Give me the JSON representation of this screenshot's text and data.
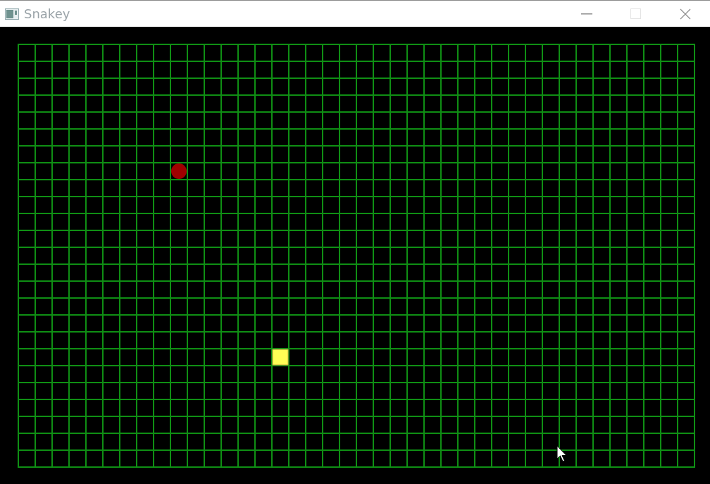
{
  "window": {
    "title": "Snakey",
    "buttons": [
      {
        "kind": "minimize",
        "disabled": false
      },
      {
        "kind": "maximize",
        "disabled": true
      },
      {
        "kind": "close",
        "disabled": false
      }
    ]
  }
}
